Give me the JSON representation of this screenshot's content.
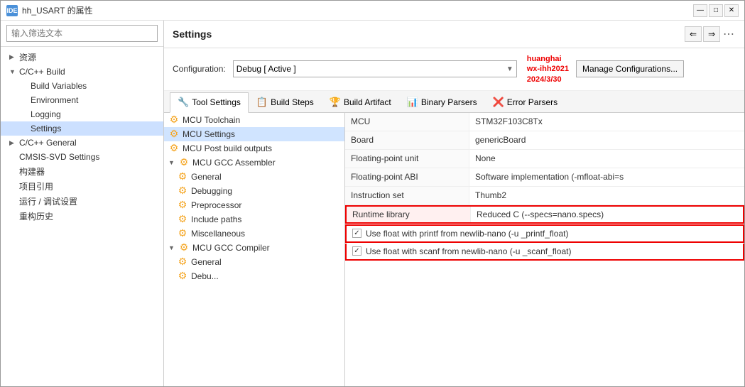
{
  "window": {
    "title": "hh_USART 的属性",
    "ide_label": "IDE"
  },
  "sidebar": {
    "search_placeholder": "输入筛选文本",
    "items": [
      {
        "id": "resources",
        "label": "资源",
        "level": 1,
        "arrow": "▶",
        "indent": "l1"
      },
      {
        "id": "cpp-build",
        "label": "C/C++ Build",
        "level": 1,
        "arrow": "▼",
        "indent": "l1",
        "expanded": true
      },
      {
        "id": "build-variables",
        "label": "Build Variables",
        "level": 2,
        "arrow": "",
        "indent": "l2"
      },
      {
        "id": "environment",
        "label": "Environment",
        "level": 2,
        "arrow": "",
        "indent": "l2"
      },
      {
        "id": "logging",
        "label": "Logging",
        "level": 2,
        "arrow": "",
        "indent": "l2"
      },
      {
        "id": "settings",
        "label": "Settings",
        "level": 2,
        "arrow": "",
        "indent": "l2",
        "selected": true
      },
      {
        "id": "cpp-general",
        "label": "C/C++ General",
        "level": 1,
        "arrow": "▶",
        "indent": "l1"
      },
      {
        "id": "cmsis-svd",
        "label": "CMSIS-SVD Settings",
        "level": 1,
        "arrow": "",
        "indent": "l1"
      },
      {
        "id": "builder",
        "label": "构建器",
        "level": 1,
        "arrow": "",
        "indent": "l1"
      },
      {
        "id": "project-ref",
        "label": "项目引用",
        "level": 1,
        "arrow": "",
        "indent": "l1"
      },
      {
        "id": "run-debug",
        "label": "运行 / 调试设置",
        "level": 1,
        "arrow": "",
        "indent": "l1"
      },
      {
        "id": "refactor-history",
        "label": "重构历史",
        "level": 1,
        "arrow": "",
        "indent": "l1"
      }
    ]
  },
  "settings_panel": {
    "title": "Settings",
    "config_label": "Configuration:",
    "config_value": "Debug  [ Active ]",
    "watermark_line1": "huanghai",
    "watermark_line2": "wx-ihh2021",
    "watermark_line3": "2024/3/30",
    "manage_btn": "Manage Configurations...",
    "tabs": [
      {
        "id": "tool-settings",
        "label": "Tool Settings",
        "icon": "🔧",
        "active": true
      },
      {
        "id": "build-steps",
        "label": "Build Steps",
        "icon": "📋"
      },
      {
        "id": "build-artifact",
        "label": "Build Artifact",
        "icon": "🏆"
      },
      {
        "id": "binary-parsers",
        "label": "Binary Parsers",
        "icon": "📊"
      },
      {
        "id": "error-parsers",
        "label": "Error Parsers",
        "icon": "❌"
      }
    ],
    "tree2": [
      {
        "id": "mcu-toolchain",
        "label": "MCU Toolchain",
        "level": "l0",
        "arrow": "",
        "icon": "⚙"
      },
      {
        "id": "mcu-settings",
        "label": "MCU Settings",
        "level": "l0",
        "arrow": "",
        "icon": "⚙",
        "selected": true
      },
      {
        "id": "mcu-post-build",
        "label": "MCU Post build outputs",
        "level": "l0",
        "arrow": "",
        "icon": "⚙"
      },
      {
        "id": "mcu-gcc-assembler",
        "label": "MCU GCC Assembler",
        "level": "l0",
        "arrow": "▼",
        "icon": "⚙",
        "expanded": true
      },
      {
        "id": "general",
        "label": "General",
        "level": "l1",
        "arrow": "",
        "icon": "⚙"
      },
      {
        "id": "debugging",
        "label": "Debugging",
        "level": "l1",
        "arrow": "",
        "icon": "⚙"
      },
      {
        "id": "preprocessor",
        "label": "Preprocessor",
        "level": "l1",
        "arrow": "",
        "icon": "⚙"
      },
      {
        "id": "include-paths",
        "label": "Include paths",
        "level": "l1",
        "arrow": "",
        "icon": "⚙"
      },
      {
        "id": "miscellaneous",
        "label": "Miscellaneous",
        "level": "l1",
        "arrow": "",
        "icon": "⚙"
      },
      {
        "id": "mcu-gcc-compiler",
        "label": "MCU GCC Compiler",
        "level": "l0",
        "arrow": "▼",
        "icon": "⚙",
        "expanded": true
      },
      {
        "id": "general2",
        "label": "General",
        "level": "l1",
        "arrow": "",
        "icon": "⚙"
      },
      {
        "id": "debug2",
        "label": "Debu...",
        "level": "l1",
        "arrow": "",
        "icon": "⚙"
      }
    ],
    "props": [
      {
        "label": "MCU",
        "value": "STM32F103C8Tx"
      },
      {
        "label": "Board",
        "value": "genericBoard"
      },
      {
        "label": "Floating-point unit",
        "value": "None"
      },
      {
        "label": "Floating-point ABI",
        "value": "Software implementation (-mfloat-abi=s"
      },
      {
        "label": "Instruction set",
        "value": "Thumb2"
      },
      {
        "label": "Runtime library",
        "value": "Reduced C (--specs=nano.specs)",
        "highlighted": true
      }
    ],
    "checkboxes": [
      {
        "id": "cb1",
        "checked": true,
        "label": "Use float with printf from newlib-nano (-u _printf_float)"
      },
      {
        "id": "cb2",
        "checked": true,
        "label": "Use float with scanf from newlib-nano (-u _scanf_float)"
      }
    ]
  },
  "nav": {
    "back_arrow": "⇐",
    "forward_arrow": "⇒",
    "dots": "⋯"
  }
}
